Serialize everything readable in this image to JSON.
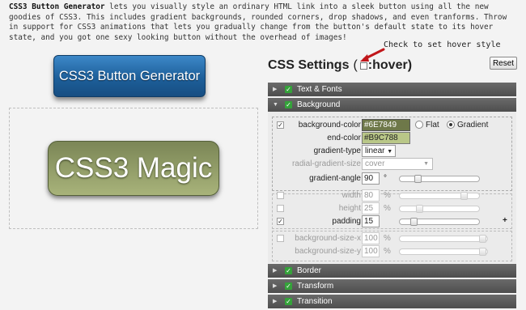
{
  "intro": {
    "title": "CSS3 Button Generator",
    "text": " lets you visually style an ordinary HTML link into a sleek button using all the new goodies of CSS3. This includes gradient backgrounds, rounded corners, drop shadows, and even tranforms. Throw in support for CSS3 animations that lets you gradually change from the button's default state to its hover state, and you got one sexy looking button without the overhead of images!"
  },
  "hero_button": {
    "label": "CSS3 Button Generator"
  },
  "preview": {
    "label": "CSS3 Magic"
  },
  "hint": {
    "text": "Check to set hover style"
  },
  "settings": {
    "title": "CSS Settings",
    "open_paren": "(",
    "hover_label": ":hover)",
    "reset_label": "Reset"
  },
  "sections": {
    "text_fonts": "Text & Fonts",
    "background": "Background",
    "border": "Border",
    "transform": "Transform",
    "transition": "Transition"
  },
  "background": {
    "bg_color_label": "background-color",
    "bg_color_value": "#6E7849",
    "flat_label": "Flat",
    "gradient_label": "Gradient",
    "end_color_label": "end-color",
    "end_color_value": "#B9C788",
    "gradient_type_label": "gradient-type",
    "gradient_type_value": "linear",
    "radial_size_label": "radial-gradient-size",
    "radial_size_value": "cover",
    "gradient_angle_label": "gradient-angle",
    "gradient_angle_value": "90",
    "gradient_angle_unit": "°",
    "width_label": "width",
    "width_value": "80",
    "width_unit": "%",
    "height_label": "height",
    "height_value": "25",
    "height_unit": "%",
    "padding_label": "padding",
    "padding_value": "15",
    "padding_plus": "+",
    "bgsize_x_label": "background-size-x",
    "bgsize_x_value": "100",
    "bgsize_x_unit": "%",
    "bgsize_y_label": "background-size-y",
    "bgsize_y_value": "100",
    "bgsize_y_unit": "%"
  },
  "colors": {
    "bg_swatch": "#6E7849",
    "end_swatch": "#B9C788",
    "section_check": "#35a23a",
    "hero": "#1d5f9a"
  },
  "icons": {
    "section_check": "green-check-icon",
    "arrow": "red-arrow-icon"
  }
}
